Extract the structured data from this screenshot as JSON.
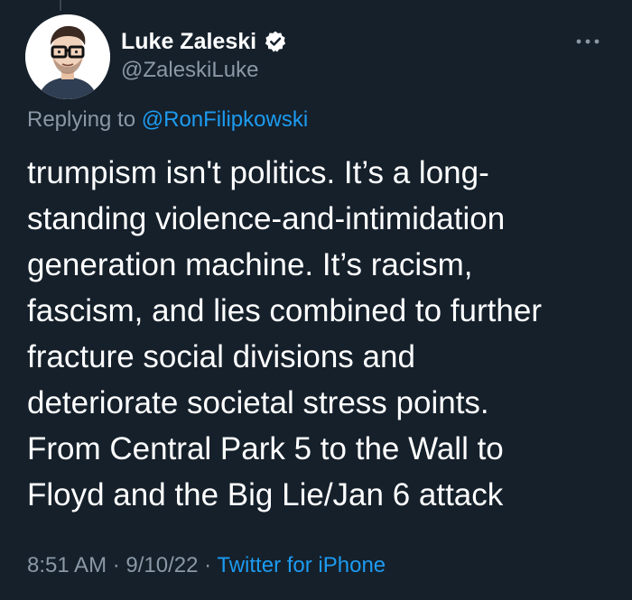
{
  "author": {
    "display_name": "Luke Zaleski",
    "handle": "@ZaleskiLuke",
    "verified": true,
    "avatar_icon": "avatar-illustration"
  },
  "reply": {
    "prefix": "Replying to",
    "mention": "@RonFilipkowski"
  },
  "tweet": {
    "lines": [
      "trumpism isn't politics. It’s a long-",
      "standing violence-and-intimidation",
      "generation machine. It’s racism,",
      "fascism, and lies combined to further",
      "fracture social divisions and",
      "deteriorate societal stress points.",
      "From Central Park 5 to the Wall to",
      "Floyd and the Big Lie/Jan 6 attack"
    ]
  },
  "meta": {
    "time": "8:51 AM",
    "separator": "·",
    "date": "9/10/22",
    "source": "Twitter for iPhone"
  },
  "colors": {
    "background": "#15202b",
    "text": "#ffffff",
    "secondary": "#8b98a5",
    "accent": "#1d9bf0"
  },
  "icons": {
    "verified": "verified-badge-icon",
    "more": "more-options-icon"
  }
}
